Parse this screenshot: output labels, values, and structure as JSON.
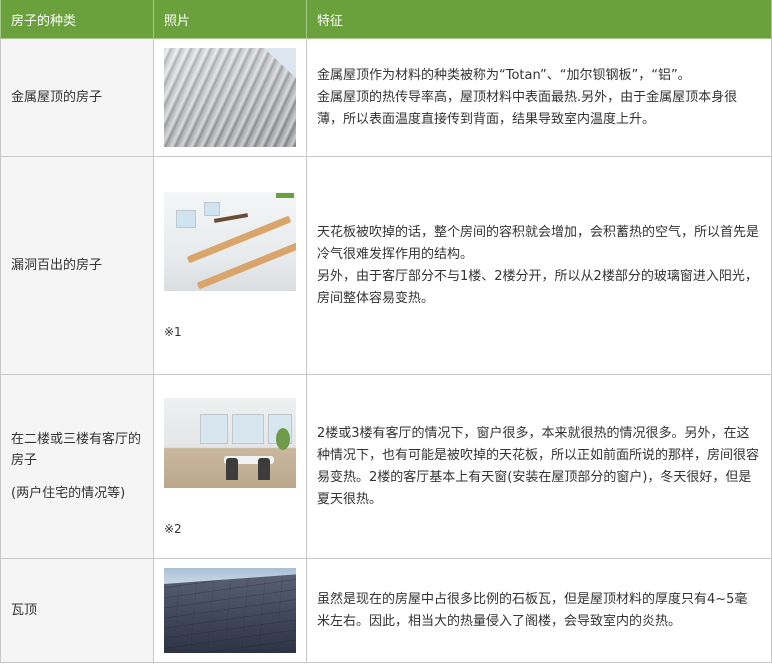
{
  "headers": {
    "type": "房子的种类",
    "photo": "照片",
    "feature": "特征"
  },
  "rows": [
    {
      "type": "金属屋顶的房子",
      "photo_icon": "corrugated-metal-roof-photo",
      "feature": "金属屋顶作为材料的种类被称为“Totan”、“加尔钡钢板”，“铝”。\n金属屋顶的热传导率高，屋顶材料中表面最热.另外，由于金属屋顶本身很薄，所以表面温度直接传到背面，结果导致室内温度上升。"
    },
    {
      "type": "漏洞百出的房子",
      "photo_icon": "vaulted-ceiling-photo",
      "photo_note": "※1",
      "feature": "天花板被吹掉的话，整个房间的容积就会增加，会积蓄热的空气，所以首先是冷气很难发挥作用的结构。\n另外，由于客厅部分不与1楼、2楼分开，所以从2楼部分的玻璃窗进入阳光，房间整体容易变热。"
    },
    {
      "type": "在二楼或三楼有客厅的房子",
      "type_sub": "(两户住宅的情况等)",
      "photo_icon": "upstairs-living-room-photo",
      "photo_note": "※2",
      "feature": "2楼或3楼有客厅的情况下，窗户很多，本来就很热的情况很多。另外，在这种情况下，也有可能是被吹掉的天花板，所以正如前面所说的那样，房间很容易变热。2楼的客厅基本上有天窗(安装在屋顶部分的窗户)，冬天很好，但是夏天很热。"
    },
    {
      "type": "瓦顶",
      "photo_icon": "slate-tile-roof-photo",
      "feature": "虽然是现在的房屋中占很多比例的石板瓦，但是屋顶材料的厚度只有4~5毫米左右。因此，相当大的热量侵入了阁楼，会导致室内的炎热。"
    }
  ],
  "colors": {
    "header_bg": "#6aa13c",
    "type_cell_bg": "#f5f5f5",
    "border": "#c8c8c8"
  }
}
